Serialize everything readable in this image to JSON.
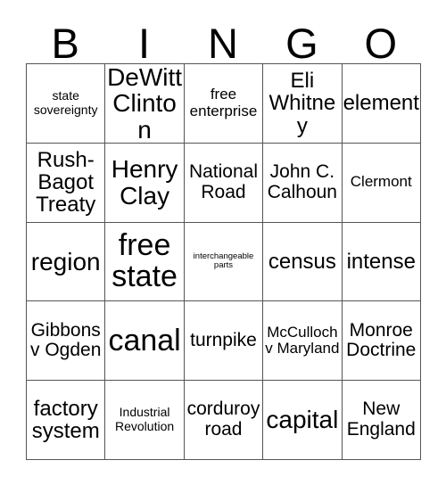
{
  "card": {
    "title_letters": [
      "B",
      "I",
      "N",
      "G",
      "O"
    ],
    "columns": 5,
    "rows": 5,
    "border_color": "#555555",
    "text_color": "#000000",
    "background_color": "#ffffff",
    "cells": [
      [
        {
          "text": "state sovereignty",
          "size": "fs-sm"
        },
        {
          "text": "DeWitt Clinton",
          "size": "fs-2xl"
        },
        {
          "text": "free enterprise",
          "size": "fs-md"
        },
        {
          "text": "Eli Whitney",
          "size": "fs-xl"
        },
        {
          "text": "element",
          "size": "fs-xl"
        }
      ],
      [
        {
          "text": "Rush-Bagot Treaty",
          "size": "fs-xl"
        },
        {
          "text": "Henry Clay",
          "size": "fs-2xl"
        },
        {
          "text": "National Road",
          "size": "fs-lg"
        },
        {
          "text": "John C. Calhoun",
          "size": "fs-lg"
        },
        {
          "text": "Clermont",
          "size": "fs-md"
        }
      ],
      [
        {
          "text": "region",
          "size": "fs-2xl"
        },
        {
          "text": "free state",
          "size": "fs-3xl"
        },
        {
          "text": "interchangeable parts",
          "size": "fs-xs"
        },
        {
          "text": "census",
          "size": "fs-xl"
        },
        {
          "text": "intense",
          "size": "fs-xl"
        }
      ],
      [
        {
          "text": "Gibbons v Ogden",
          "size": "fs-lg"
        },
        {
          "text": "canal",
          "size": "fs-3xl"
        },
        {
          "text": "turnpike",
          "size": "fs-lg"
        },
        {
          "text": "McCulloch v Maryland",
          "size": "fs-md"
        },
        {
          "text": "Monroe Doctrine",
          "size": "fs-lg"
        }
      ],
      [
        {
          "text": "factory system",
          "size": "fs-xl"
        },
        {
          "text": "Industrial Revolution",
          "size": "fs-sm"
        },
        {
          "text": "corduroy road",
          "size": "fs-lg"
        },
        {
          "text": "capital",
          "size": "fs-2xl"
        },
        {
          "text": "New England",
          "size": "fs-lg"
        }
      ]
    ]
  }
}
